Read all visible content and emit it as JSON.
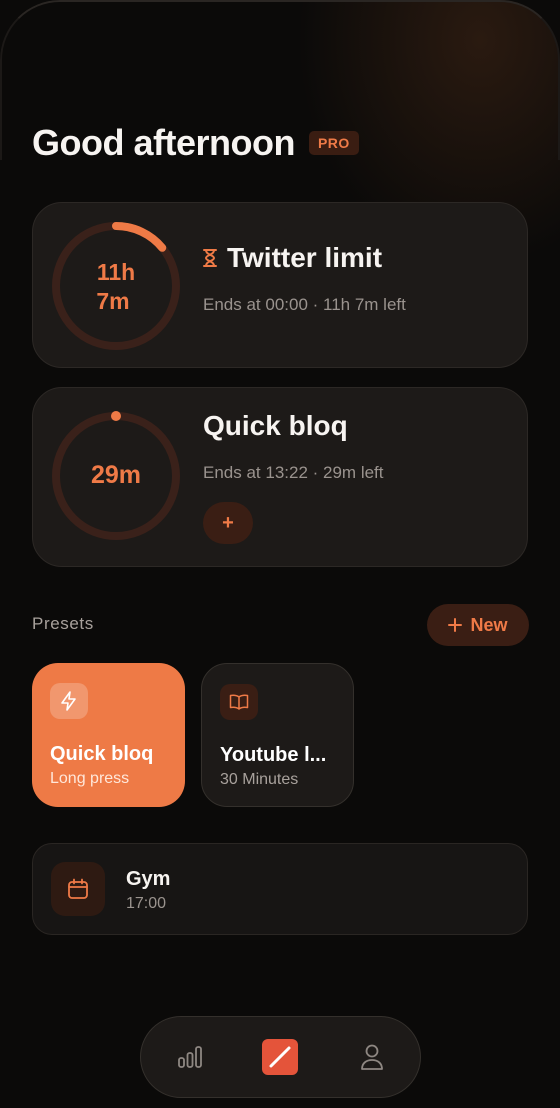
{
  "header": {
    "greeting": "Good afternoon",
    "badge": "PRO"
  },
  "active_blocks": [
    {
      "ring_line1": "11h",
      "ring_line2": "7m",
      "progress": 0.14,
      "title_icon": "hourglass-icon",
      "title": "Twitter limit",
      "subtitle": "Ends at 00:00 · 11h 7m left"
    },
    {
      "ring_text": "29m",
      "progress": 0.0,
      "title": "Quick bloq",
      "subtitle": "Ends at 13:22 · 29m left",
      "add_label": "+"
    }
  ],
  "presets": {
    "label": "Presets",
    "new_label": "New",
    "new_icon": "plus-icon",
    "items": [
      {
        "icon": "lightning-icon",
        "title": "Quick bloq",
        "subtitle": "Long press"
      },
      {
        "icon": "book-icon",
        "title": "Youtube l...",
        "subtitle": "30 Minutes"
      }
    ]
  },
  "schedule": {
    "icon": "calendar-icon",
    "title": "Gym",
    "time": "17:00"
  },
  "tabbar": {
    "items": [
      {
        "icon": "bar-chart-icon"
      },
      {
        "icon": "block-icon",
        "active": true
      },
      {
        "icon": "person-icon"
      }
    ]
  },
  "colors": {
    "accent": "#ee7a46",
    "background": "#0b0a09",
    "card": "#1d1a18",
    "tab_active": "#e4543a"
  }
}
